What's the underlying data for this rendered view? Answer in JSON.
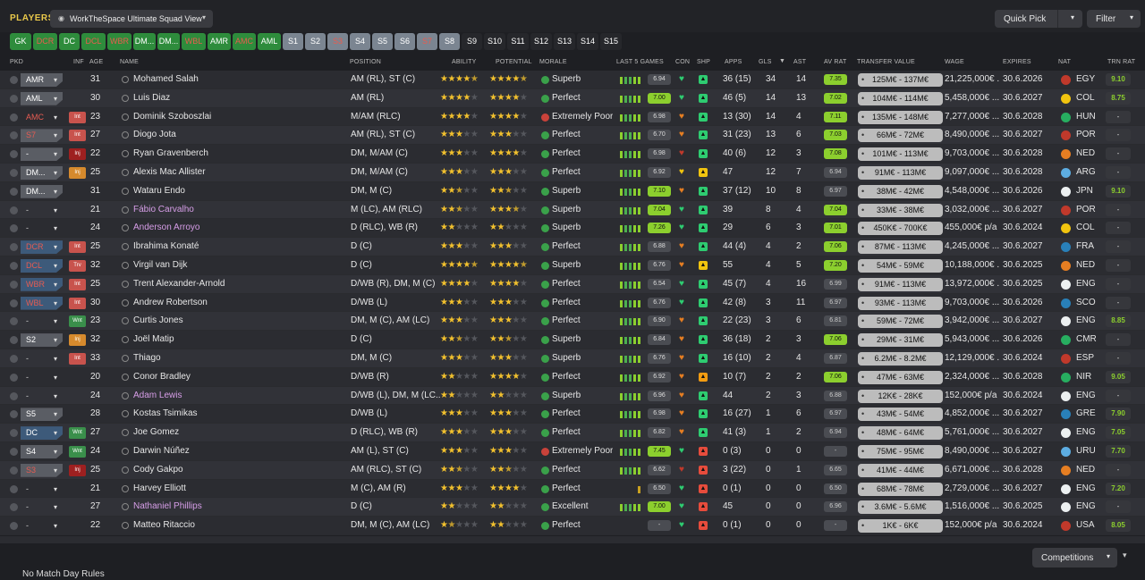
{
  "header": {
    "title": "PLAYERS",
    "view_label": "WorkTheSpace Ultimate Squad View",
    "quick_pick": "Quick Pick",
    "filter": "Filter"
  },
  "chips": [
    {
      "label": "GK",
      "style": "green"
    },
    {
      "label": "DCR",
      "style": "green redtxt"
    },
    {
      "label": "DC",
      "style": "green"
    },
    {
      "label": "DCL",
      "style": "green redtxt"
    },
    {
      "label": "WBR",
      "style": "green redtxt"
    },
    {
      "label": "DM...",
      "style": "green"
    },
    {
      "label": "DM...",
      "style": "green"
    },
    {
      "label": "WBL",
      "style": "green redtxt"
    },
    {
      "label": "AMR",
      "style": "green"
    },
    {
      "label": "AMC",
      "style": "green redtxt"
    },
    {
      "label": "AML",
      "style": "green"
    },
    {
      "label": "S1",
      "style": "grey"
    },
    {
      "label": "S2",
      "style": "grey"
    },
    {
      "label": "S3",
      "style": "grey redtxt"
    },
    {
      "label": "S4",
      "style": "grey"
    },
    {
      "label": "S5",
      "style": "grey"
    },
    {
      "label": "S6",
      "style": "grey"
    },
    {
      "label": "S7",
      "style": "grey redtxt"
    },
    {
      "label": "S8",
      "style": "grey"
    },
    {
      "label": "S9",
      "style": "dark"
    },
    {
      "label": "S10",
      "style": "dark"
    },
    {
      "label": "S11",
      "style": "dark"
    },
    {
      "label": "S12",
      "style": "dark"
    },
    {
      "label": "S13",
      "style": "dark"
    },
    {
      "label": "S14",
      "style": "dark"
    },
    {
      "label": "S15",
      "style": "dark"
    }
  ],
  "columns": {
    "pkd": "PKD",
    "inf": "INF",
    "age": "AGE",
    "name": "NAME",
    "position": "POSITION",
    "ability": "ABILITY",
    "potential": "POTENTIAL",
    "morale": "MORALE",
    "last5": "LAST 5 GAMES",
    "con": "CON",
    "shp": "SHP",
    "apps": "APPS",
    "gls": "GLS",
    "ast": "AST",
    "avrat": "AV RAT",
    "tv": "TRANSFER VALUE",
    "wage": "WAGE",
    "expires": "EXPIRES",
    "nat": "NAT",
    "trnrat": "TRN RAT"
  },
  "players": [
    {
      "pkd": "AMR",
      "pkdStyle": "grey",
      "inf": "",
      "age": "31",
      "name": "Mohamed Salah",
      "pos": "AM (RL), ST (C)",
      "ab": 4.5,
      "pot": 4.5,
      "morale": "Superb",
      "mor": "g",
      "bars": "ggggg",
      "form": "6.94",
      "formHi": false,
      "con": "#2ecc71",
      "shp": "#2ecc71",
      "apps": "36 (15)",
      "gls": "34",
      "ast": "14",
      "av": "7.35",
      "avHi": true,
      "tv": "125M€ - 137M€",
      "wage": "21,225,000€ ...",
      "exp": "30.6.2026",
      "flag": "#c0392b",
      "nat": "EGY",
      "trn": "9.10",
      "trnGood": true,
      "alt": false,
      "loan": false
    },
    {
      "pkd": "AML",
      "pkdStyle": "grey",
      "inf": "",
      "age": "30",
      "name": "Luis Diaz",
      "pos": "AM (RL)",
      "ab": 4,
      "pot": 4,
      "morale": "Perfect",
      "mor": "g",
      "bars": "ggggg",
      "form": "7.00",
      "formHi": true,
      "con": "#2ecc71",
      "shp": "#2ecc71",
      "apps": "46 (5)",
      "gls": "14",
      "ast": "13",
      "av": "7.02",
      "avHi": true,
      "tv": "104M€ - 114M€",
      "wage": "5,458,000€ ...",
      "exp": "30.6.2027",
      "flag": "#f1c40f",
      "nat": "COL",
      "trn": "8.75",
      "trnGood": true,
      "alt": true,
      "loan": false
    },
    {
      "pkd": "AMC",
      "pkdStyle": "none redtxt",
      "inf": "Int",
      "infStyle": "red",
      "age": "23",
      "name": "Dominik Szoboszlai",
      "pos": "M/AM (RLC)",
      "ab": 4,
      "pot": 4,
      "morale": "Extremely Poor",
      "mor": "r",
      "bars": "ggggg",
      "form": "6.98",
      "formHi": false,
      "con": "#e67e22",
      "shp": "#2ecc71",
      "apps": "13 (30)",
      "gls": "14",
      "ast": "4",
      "av": "7.11",
      "avHi": true,
      "tv": "135M€ - 148M€",
      "wage": "7,277,000€ ...",
      "exp": "30.6.2028",
      "flag": "#27ae60",
      "nat": "HUN",
      "trn": "-",
      "trnGood": false,
      "alt": false,
      "loan": false
    },
    {
      "pkd": "S7",
      "pkdStyle": "grey redtxt",
      "inf": "Int",
      "infStyle": "red",
      "age": "27",
      "name": "Diogo Jota",
      "pos": "AM (RL), ST (C)",
      "ab": 3,
      "pot": 3,
      "morale": "Perfect",
      "mor": "g",
      "bars": "ggggg",
      "form": "6.70",
      "formHi": false,
      "con": "#e67e22",
      "shp": "#2ecc71",
      "apps": "31 (23)",
      "gls": "13",
      "ast": "6",
      "av": "7.03",
      "avHi": true,
      "tv": "66M€ - 72M€",
      "wage": "8,490,000€ ...",
      "exp": "30.6.2027",
      "flag": "#c0392b",
      "nat": "POR",
      "trn": "-",
      "trnGood": false,
      "alt": true,
      "loan": false
    },
    {
      "pkd": "-",
      "pkdStyle": "grey",
      "inf": "Inj",
      "infStyle": "darkred",
      "age": "22",
      "name": "Ryan Gravenberch",
      "pos": "DM, M/AM (C)",
      "ab": 3,
      "pot": 4,
      "morale": "Perfect",
      "mor": "g",
      "bars": "ggggg",
      "form": "6.98",
      "formHi": false,
      "con": "#c0392b",
      "shp": "#2ecc71",
      "apps": "40 (6)",
      "gls": "12",
      "ast": "3",
      "av": "7.08",
      "avHi": true,
      "tv": "101M€ - 113M€",
      "wage": "9,703,000€ ...",
      "exp": "30.6.2028",
      "flag": "#e67e22",
      "nat": "NED",
      "trn": "-",
      "trnGood": false,
      "alt": false,
      "loan": false
    },
    {
      "pkd": "DM...",
      "pkdStyle": "grey",
      "inf": "Inj",
      "infStyle": "orange",
      "age": "25",
      "name": "Alexis Mac Allister",
      "pos": "DM, M/AM (C)",
      "ab": 3,
      "pot": 3,
      "morale": "Perfect",
      "mor": "g",
      "bars": "ggggg",
      "form": "6.92",
      "formHi": false,
      "con": "#f1c40f",
      "shp": "#f1c40f",
      "apps": "47",
      "gls": "12",
      "ast": "7",
      "av": "6.94",
      "avHi": false,
      "tv": "91M€ - 113M€",
      "wage": "9,097,000€ ...",
      "exp": "30.6.2028",
      "flag": "#5dade2",
      "nat": "ARG",
      "trn": "-",
      "trnGood": false,
      "alt": true,
      "loan": false
    },
    {
      "pkd": "DM...",
      "pkdStyle": "grey",
      "inf": "",
      "age": "31",
      "name": "Wataru Endo",
      "pos": "DM, M (C)",
      "ab": 2.5,
      "pot": 2.5,
      "morale": "Superb",
      "mor": "g",
      "bars": "ggggg",
      "form": "7.10",
      "formHi": true,
      "con": "#e67e22",
      "shp": "#2ecc71",
      "apps": "37 (12)",
      "gls": "10",
      "ast": "8",
      "av": "6.97",
      "avHi": false,
      "tv": "38M€ - 42M€",
      "wage": "4,548,000€ ...",
      "exp": "30.6.2026",
      "flag": "#ecf0f1",
      "nat": "JPN",
      "trn": "9.10",
      "trnGood": true,
      "alt": false,
      "loan": false
    },
    {
      "pkd": "-",
      "pkdStyle": "none",
      "inf": "",
      "age": "21",
      "name": "Fábio Carvalho",
      "pos": "M (LC), AM (RLC)",
      "ab": 2.5,
      "pot": 3.5,
      "morale": "Superb",
      "mor": "g",
      "bars": "ggggg",
      "form": "7.04",
      "formHi": true,
      "con": "#2ecc71",
      "shp": "#2ecc71",
      "apps": "39",
      "gls": "8",
      "ast": "4",
      "av": "7.04",
      "avHi": true,
      "tv": "33M€ - 38M€",
      "wage": "3,032,000€ ...",
      "exp": "30.6.2027",
      "flag": "#c0392b",
      "nat": "POR",
      "trn": "-",
      "trnGood": false,
      "alt": true,
      "loan": true
    },
    {
      "pkd": "-",
      "pkdStyle": "none",
      "inf": "",
      "age": "24",
      "name": "Anderson Arroyo",
      "pos": "D (RLC), WB (R)",
      "ab": 2,
      "pot": 2,
      "morale": "Superb",
      "mor": "g",
      "bars": "ggggg",
      "form": "7.26",
      "formHi": true,
      "con": "#2ecc71",
      "shp": "#2ecc71",
      "apps": "29",
      "gls": "6",
      "ast": "3",
      "av": "7.01",
      "avHi": true,
      "tv": "450K€ - 700K€",
      "wage": "455,000€ p/a",
      "exp": "30.6.2024",
      "flag": "#f1c40f",
      "nat": "COL",
      "trn": "-",
      "trnGood": false,
      "alt": false,
      "loan": true
    },
    {
      "pkd": "DCR",
      "pkdStyle": "blue redtxt",
      "inf": "Int",
      "infStyle": "red",
      "age": "25",
      "name": "Ibrahima Konaté",
      "pos": "D (C)",
      "ab": 3,
      "pot": 3,
      "morale": "Perfect",
      "mor": "g",
      "bars": "ggggg",
      "form": "6.88",
      "formHi": false,
      "con": "#e67e22",
      "shp": "#2ecc71",
      "apps": "44 (4)",
      "gls": "4",
      "ast": "2",
      "av": "7.06",
      "avHi": true,
      "tv": "87M€ - 113M€",
      "wage": "4,245,000€ ...",
      "exp": "30.6.2027",
      "flag": "#2980b9",
      "nat": "FRA",
      "trn": "-",
      "trnGood": false,
      "alt": true,
      "loan": false
    },
    {
      "pkd": "DCL",
      "pkdStyle": "blue redtxt",
      "inf": "Trv",
      "infStyle": "red",
      "age": "32",
      "name": "Virgil van Dijk",
      "pos": "D (C)",
      "ab": 4.5,
      "pot": 4.5,
      "morale": "Superb",
      "mor": "g",
      "bars": "ggggg",
      "form": "6.76",
      "formHi": false,
      "con": "#e67e22",
      "shp": "#f1c40f",
      "apps": "55",
      "gls": "4",
      "ast": "5",
      "av": "7.20",
      "avHi": true,
      "tv": "54M€ - 59M€",
      "wage": "10,188,000€ ...",
      "exp": "30.6.2025",
      "flag": "#e67e22",
      "nat": "NED",
      "trn": "-",
      "trnGood": false,
      "alt": false,
      "loan": false
    },
    {
      "pkd": "WBR",
      "pkdStyle": "blue redtxt",
      "inf": "Int",
      "infStyle": "red",
      "age": "25",
      "name": "Trent Alexander-Arnold",
      "pos": "D/WB (R), DM, M (C)",
      "ab": 4,
      "pot": 4,
      "morale": "Perfect",
      "mor": "g",
      "bars": "ggggg",
      "form": "6.54",
      "formHi": false,
      "con": "#2ecc71",
      "shp": "#2ecc71",
      "apps": "45 (7)",
      "gls": "4",
      "ast": "16",
      "av": "6.99",
      "avHi": false,
      "tv": "91M€ - 113M€",
      "wage": "13,972,000€ ...",
      "exp": "30.6.2025",
      "flag": "#ecf0f1",
      "nat": "ENG",
      "trn": "-",
      "trnGood": false,
      "alt": true,
      "loan": false
    },
    {
      "pkd": "WBL",
      "pkdStyle": "blue redtxt",
      "inf": "Int",
      "infStyle": "red",
      "age": "30",
      "name": "Andrew Robertson",
      "pos": "D/WB (L)",
      "ab": 3,
      "pot": 3,
      "morale": "Perfect",
      "mor": "g",
      "bars": "ggggg",
      "form": "6.76",
      "formHi": false,
      "con": "#2ecc71",
      "shp": "#2ecc71",
      "apps": "42 (8)",
      "gls": "3",
      "ast": "11",
      "av": "6.97",
      "avHi": false,
      "tv": "93M€ - 113M€",
      "wage": "9,703,000€ ...",
      "exp": "30.6.2026",
      "flag": "#2980b9",
      "nat": "SCO",
      "trn": "-",
      "trnGood": false,
      "alt": false,
      "loan": false
    },
    {
      "pkd": "-",
      "pkdStyle": "none",
      "inf": "Wnt",
      "infStyle": "green",
      "age": "23",
      "name": "Curtis Jones",
      "pos": "DM, M (C), AM (LC)",
      "ab": 3,
      "pot": 3,
      "morale": "Perfect",
      "mor": "g",
      "bars": "ggggg",
      "form": "6.90",
      "formHi": false,
      "con": "#e67e22",
      "shp": "#2ecc71",
      "apps": "22 (23)",
      "gls": "3",
      "ast": "6",
      "av": "6.81",
      "avHi": false,
      "tv": "59M€ - 72M€",
      "wage": "3,942,000€ ...",
      "exp": "30.6.2027",
      "flag": "#ecf0f1",
      "nat": "ENG",
      "trn": "8.85",
      "trnGood": true,
      "alt": true,
      "loan": false
    },
    {
      "pkd": "S2",
      "pkdStyle": "grey",
      "inf": "Inj",
      "infStyle": "orange",
      "age": "32",
      "name": "Joël Matip",
      "pos": "D (C)",
      "ab": 2.5,
      "pot": 2.5,
      "morale": "Superb",
      "mor": "g",
      "bars": "ggggg",
      "form": "6.84",
      "formHi": false,
      "con": "#e67e22",
      "shp": "#2ecc71",
      "apps": "36 (18)",
      "gls": "2",
      "ast": "3",
      "av": "7.06",
      "avHi": true,
      "tv": "29M€ - 31M€",
      "wage": "5,943,000€ ...",
      "exp": "30.6.2026",
      "flag": "#27ae60",
      "nat": "CMR",
      "trn": "-",
      "trnGood": false,
      "alt": false,
      "loan": false
    },
    {
      "pkd": "-",
      "pkdStyle": "none",
      "inf": "Int",
      "infStyle": "red",
      "age": "33",
      "name": "Thiago",
      "pos": "DM, M (C)",
      "ab": 3,
      "pot": 3,
      "morale": "Superb",
      "mor": "g",
      "bars": "ggggg",
      "form": "6.76",
      "formHi": false,
      "con": "#e67e22",
      "shp": "#2ecc71",
      "apps": "16 (10)",
      "gls": "2",
      "ast": "4",
      "av": "6.87",
      "avHi": false,
      "tv": "6.2M€ - 8.2M€",
      "wage": "12,129,000€ ...",
      "exp": "30.6.2024",
      "flag": "#c0392b",
      "nat": "ESP",
      "trn": "-",
      "trnGood": false,
      "alt": true,
      "loan": false
    },
    {
      "pkd": "-",
      "pkdStyle": "none",
      "inf": "",
      "age": "20",
      "name": "Conor Bradley",
      "pos": "D/WB (R)",
      "ab": 2,
      "pot": 4,
      "morale": "Perfect",
      "mor": "g",
      "bars": "ggggg",
      "form": "6.92",
      "formHi": false,
      "con": "#e67e22",
      "shp": "#f39c12",
      "apps": "10 (7)",
      "gls": "2",
      "ast": "2",
      "av": "7.06",
      "avHi": true,
      "tv": "47M€ - 63M€",
      "wage": "2,324,000€ ...",
      "exp": "30.6.2028",
      "flag": "#27ae60",
      "nat": "NIR",
      "trn": "9.05",
      "trnGood": true,
      "alt": false,
      "loan": false
    },
    {
      "pkd": "-",
      "pkdStyle": "none",
      "inf": "",
      "age": "24",
      "name": "Adam Lewis",
      "pos": "D/WB (L), DM, M (LC...",
      "ab": 2,
      "pot": 2,
      "morale": "Superb",
      "mor": "g",
      "bars": "ggggg",
      "form": "6.96",
      "formHi": false,
      "con": "#e67e22",
      "shp": "#2ecc71",
      "apps": "44",
      "gls": "2",
      "ast": "3",
      "av": "6.88",
      "avHi": false,
      "tv": "12K€ - 28K€",
      "wage": "152,000€ p/a",
      "exp": "30.6.2024",
      "flag": "#ecf0f1",
      "nat": "ENG",
      "trn": "-",
      "trnGood": false,
      "alt": true,
      "loan": true
    },
    {
      "pkd": "S5",
      "pkdStyle": "grey",
      "inf": "",
      "age": "28",
      "name": "Kostas Tsimikas",
      "pos": "D/WB (L)",
      "ab": 3,
      "pot": 3,
      "morale": "Perfect",
      "mor": "g",
      "bars": "ggggg",
      "form": "6.98",
      "formHi": false,
      "con": "#e67e22",
      "shp": "#2ecc71",
      "apps": "16 (27)",
      "gls": "1",
      "ast": "6",
      "av": "6.97",
      "avHi": false,
      "tv": "43M€ - 54M€",
      "wage": "4,852,000€ ...",
      "exp": "30.6.2027",
      "flag": "#2980b9",
      "nat": "GRE",
      "trn": "7.90",
      "trnGood": true,
      "alt": false,
      "loan": false
    },
    {
      "pkd": "DC",
      "pkdStyle": "blue",
      "inf": "Wnt",
      "infStyle": "green",
      "age": "27",
      "name": "Joe Gomez",
      "pos": "D (RLC), WB (R)",
      "ab": 3,
      "pot": 3,
      "morale": "Perfect",
      "mor": "g",
      "bars": "ggggg",
      "form": "6.82",
      "formHi": false,
      "con": "#e67e22",
      "shp": "#2ecc71",
      "apps": "41 (3)",
      "gls": "1",
      "ast": "2",
      "av": "6.94",
      "avHi": false,
      "tv": "48M€ - 64M€",
      "wage": "5,761,000€ ...",
      "exp": "30.6.2027",
      "flag": "#ecf0f1",
      "nat": "ENG",
      "trn": "7.05",
      "trnGood": true,
      "alt": true,
      "loan": false
    },
    {
      "pkd": "S4",
      "pkdStyle": "grey",
      "inf": "Wnt",
      "infStyle": "green",
      "age": "24",
      "name": "Darwin Núñez",
      "pos": "AM (L), ST (C)",
      "ab": 3,
      "pot": 3,
      "morale": "Extremely Poor",
      "mor": "r",
      "bars": "ggggg",
      "form": "7.45",
      "formHi": true,
      "con": "#2ecc71",
      "shp": "#e74c3c",
      "apps": "0 (3)",
      "gls": "0",
      "ast": "0",
      "av": "-",
      "avHi": false,
      "tv": "75M€ - 95M€",
      "wage": "8,490,000€ ...",
      "exp": "30.6.2027",
      "flag": "#5dade2",
      "nat": "URU",
      "trn": "7.70",
      "trnGood": true,
      "alt": false,
      "loan": false
    },
    {
      "pkd": "S3",
      "pkdStyle": "grey redtxt",
      "inf": "Inj",
      "infStyle": "darkred",
      "age": "25",
      "name": "Cody Gakpo",
      "pos": "AM (RLC), ST (C)",
      "ab": 2.5,
      "pot": 2.5,
      "morale": "Perfect",
      "mor": "g",
      "bars": "ggggg",
      "form": "6.62",
      "formHi": false,
      "con": "#c0392b",
      "shp": "#e74c3c",
      "apps": "3 (22)",
      "gls": "0",
      "ast": "1",
      "av": "6.65",
      "avHi": false,
      "tv": "41M€ - 44M€",
      "wage": "6,671,000€ ...",
      "exp": "30.6.2028",
      "flag": "#e67e22",
      "nat": "NED",
      "trn": "-",
      "trnGood": false,
      "alt": true,
      "loan": false
    },
    {
      "pkd": "-",
      "pkdStyle": "none",
      "inf": "",
      "age": "21",
      "name": "Harvey Elliott",
      "pos": "M (C), AM (R)",
      "ab": 3,
      "pot": 4,
      "morale": "Perfect",
      "mor": "g",
      "bars": "y",
      "form": "6.50",
      "formHi": false,
      "con": "#2ecc71",
      "shp": "#e74c3c",
      "apps": "0 (1)",
      "gls": "0",
      "ast": "0",
      "av": "6.50",
      "avHi": false,
      "tv": "68M€ - 78M€",
      "wage": "2,729,000€ ...",
      "exp": "30.6.2027",
      "flag": "#ecf0f1",
      "nat": "ENG",
      "trn": "7.20",
      "trnGood": true,
      "alt": false,
      "loan": false
    },
    {
      "pkd": "-",
      "pkdStyle": "none",
      "inf": "",
      "age": "27",
      "name": "Nathaniel Phillips",
      "pos": "D (C)",
      "ab": 2,
      "pot": 2,
      "morale": "Excellent",
      "mor": "g",
      "bars": "ggggg",
      "form": "7.00",
      "formHi": true,
      "con": "#2ecc71",
      "shp": "#e74c3c",
      "apps": "45",
      "gls": "0",
      "ast": "0",
      "av": "6.96",
      "avHi": false,
      "tv": "3.6M€ - 5.6M€",
      "wage": "1,516,000€ ...",
      "exp": "30.6.2025",
      "flag": "#ecf0f1",
      "nat": "ENG",
      "trn": "-",
      "trnGood": false,
      "alt": true,
      "loan": true
    },
    {
      "pkd": "-",
      "pkdStyle": "none",
      "inf": "",
      "age": "22",
      "name": "Matteo Ritaccio",
      "pos": "DM, M (C), AM (LC)",
      "ab": 1.5,
      "pot": 2,
      "morale": "Perfect",
      "mor": "g",
      "bars": "",
      "form": "-",
      "formHi": false,
      "con": "#2ecc71",
      "shp": "#e74c3c",
      "apps": "0 (1)",
      "gls": "0",
      "ast": "0",
      "av": "-",
      "avHi": false,
      "tv": "1K€ - 6K€",
      "wage": "152,000€ p/a",
      "exp": "30.6.2024",
      "flag": "#c0392b",
      "nat": "USA",
      "trn": "8.05",
      "trnGood": true,
      "alt": false,
      "loan": false
    }
  ],
  "footer": {
    "text": "No Match Day Rules",
    "competitions": "Competitions"
  }
}
